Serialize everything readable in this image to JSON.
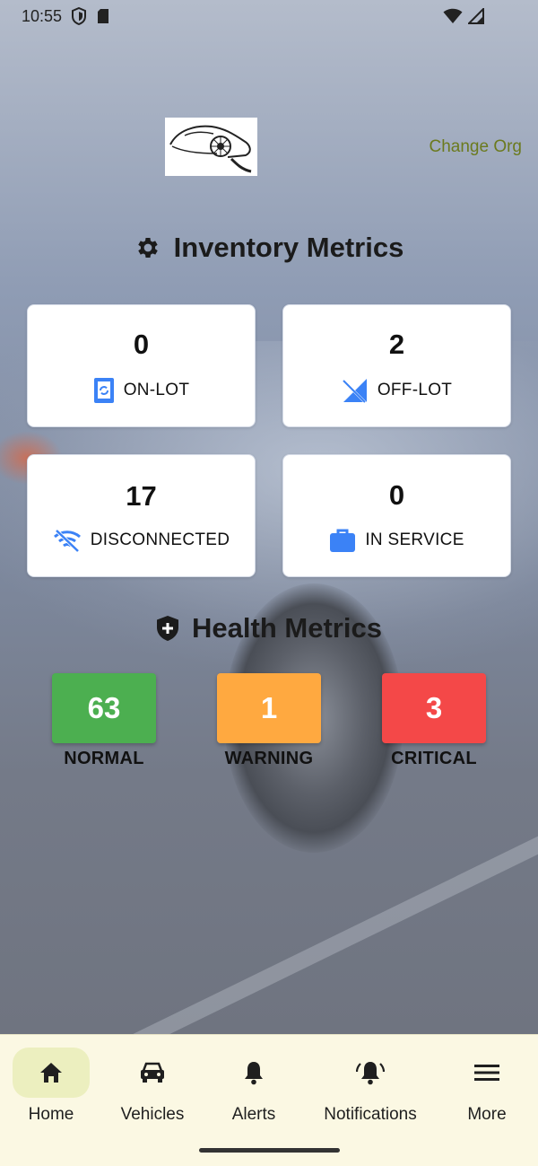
{
  "status_bar": {
    "time": "10:55"
  },
  "header": {
    "change_org_label": "Change Org"
  },
  "inventory": {
    "title": "Inventory Metrics",
    "cards": [
      {
        "value": "0",
        "label": "ON-LOT",
        "icon": "phone-sync-icon"
      },
      {
        "value": "2",
        "label": "OFF-LOT",
        "icon": "signal-off-icon"
      },
      {
        "value": "17",
        "label": "DISCONNECTED",
        "icon": "wifi-off-icon"
      },
      {
        "value": "0",
        "label": "IN SERVICE",
        "icon": "briefcase-icon"
      }
    ]
  },
  "health": {
    "title": "Health Metrics",
    "items": [
      {
        "value": "63",
        "label": "NORMAL",
        "color": "#4caf50"
      },
      {
        "value": "1",
        "label": "WARNING",
        "color": "#ffa940"
      },
      {
        "value": "3",
        "label": "CRITICAL",
        "color": "#f44848"
      }
    ]
  },
  "colors": {
    "icon_blue": "#3b82f6",
    "change_org": "#6b7a1e",
    "nav_bg": "#fbf8e3",
    "nav_active": "#ecefbf"
  },
  "nav": {
    "items": [
      {
        "label": "Home",
        "icon": "home-icon",
        "active": true
      },
      {
        "label": "Vehicles",
        "icon": "car-icon",
        "active": false
      },
      {
        "label": "Alerts",
        "icon": "bell-icon",
        "active": false
      },
      {
        "label": "Notifications",
        "icon": "bell-ring-icon",
        "active": false
      },
      {
        "label": "More",
        "icon": "menu-icon",
        "active": false
      }
    ]
  }
}
